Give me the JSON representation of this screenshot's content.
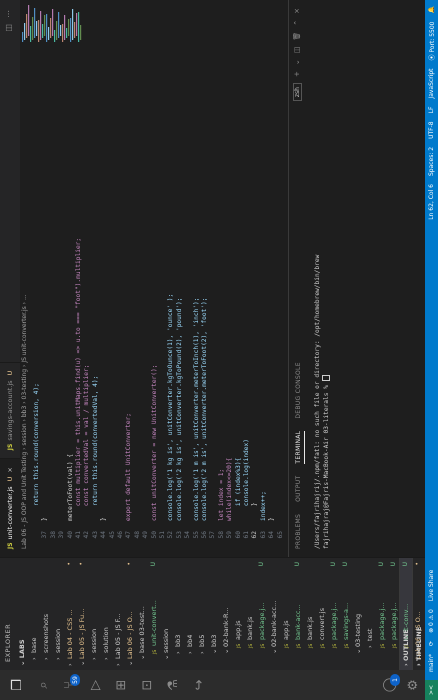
{
  "activity_bar": {
    "icons": [
      "explorer-icon",
      "search-icon",
      "source-control-icon",
      "run-debug-icon",
      "extensions-icon",
      "remote-explorer-icon",
      "testing-icon",
      "live-share-icon"
    ],
    "source_control_badge": "59",
    "bottom_icons": [
      "account-icon",
      "settings-icon"
    ],
    "account_badge": "1"
  },
  "sidebar": {
    "header": "EXPLORER",
    "section": "LABS",
    "items": [
      {
        "label": "base",
        "indent": 1,
        "arrow": "›",
        "status": "",
        "state": ""
      },
      {
        "label": "screenshots",
        "indent": 1,
        "arrow": "›",
        "status": "",
        "state": ""
      },
      {
        "label": "session",
        "indent": 1,
        "arrow": "›",
        "status": "",
        "state": ""
      },
      {
        "label": "Lab 04 - CSS ...",
        "indent": 0,
        "arrow": "›",
        "status": "•",
        "state": "mod"
      },
      {
        "label": "Lab 05 - JS Fu...",
        "indent": 0,
        "arrow": "⌄",
        "status": "•",
        "state": "mod"
      },
      {
        "label": "session",
        "indent": 1,
        "arrow": "›",
        "status": "",
        "state": ""
      },
      {
        "label": "solution",
        "indent": 1,
        "arrow": "›",
        "status": "",
        "state": ""
      },
      {
        "label": "Lab 05 - JS F...",
        "indent": 0,
        "arrow": "›",
        "status": "",
        "state": ""
      },
      {
        "label": "Lab 06 - JS O...",
        "indent": 0,
        "arrow": "⌄",
        "status": "•",
        "state": "mod"
      },
      {
        "label": "base 03-test...",
        "indent": 1,
        "arrow": "⌄",
        "status": "",
        "state": ""
      },
      {
        "label": "unit-convert...",
        "indent": 2,
        "arrow": "",
        "status": "U",
        "state": "untr"
      },
      {
        "label": "session",
        "indent": 1,
        "arrow": "⌄",
        "status": "",
        "state": ""
      },
      {
        "label": "bb3",
        "indent": 2,
        "arrow": "›",
        "status": "",
        "state": ""
      },
      {
        "label": "bb4",
        "indent": 2,
        "arrow": "›",
        "status": "",
        "state": ""
      },
      {
        "label": "bb5",
        "indent": 2,
        "arrow": "›",
        "status": "",
        "state": ""
      },
      {
        "label": "bb3",
        "indent": 2,
        "arrow": "⌄",
        "status": "",
        "state": ""
      },
      {
        "label": "02-bank-R...",
        "indent": 2,
        "arrow": "⌄",
        "status": "",
        "state": ""
      },
      {
        "label": "app.js",
        "indent": 3,
        "arrow": "",
        "status": "",
        "state": ""
      },
      {
        "label": "bank.js",
        "indent": 3,
        "arrow": "",
        "status": "",
        "state": ""
      },
      {
        "label": "package.j...",
        "indent": 3,
        "arrow": "",
        "status": "U",
        "state": "untr"
      },
      {
        "label": "02-bank-acc...",
        "indent": 2,
        "arrow": "⌄",
        "status": "",
        "state": ""
      },
      {
        "label": "app.js",
        "indent": 3,
        "arrow": "",
        "status": "",
        "state": ""
      },
      {
        "label": "bank-acc...",
        "indent": 3,
        "arrow": "",
        "status": "U",
        "state": "untr"
      },
      {
        "label": "bank.js",
        "indent": 3,
        "arrow": "",
        "status": "",
        "state": ""
      },
      {
        "label": "convert.js",
        "indent": 3,
        "arrow": "",
        "status": "",
        "state": ""
      },
      {
        "label": "package.j...",
        "indent": 3,
        "arrow": "",
        "status": "U",
        "state": "untr"
      },
      {
        "label": "savings-a...",
        "indent": 3,
        "arrow": "",
        "status": "U",
        "state": "untr"
      },
      {
        "label": "03-testing",
        "indent": 2,
        "arrow": "⌄",
        "status": "",
        "state": ""
      },
      {
        "label": "test",
        "indent": 3,
        "arrow": "›",
        "status": "",
        "state": ""
      },
      {
        "label": "package.j...",
        "indent": 3,
        "arrow": "",
        "status": "U",
        "state": "untr"
      },
      {
        "label": "package.j...",
        "indent": 3,
        "arrow": "",
        "status": "U",
        "state": "untr"
      },
      {
        "label": "unit-conv...",
        "indent": 3,
        "arrow": "",
        "status": "U",
        "state": "untr sel"
      },
      {
        "label": "Lab 06 - JS O...",
        "indent": 0,
        "arrow": "›",
        "status": "•",
        "state": "mod"
      },
      {
        "label": "Lab 07 - Classes",
        "indent": 0,
        "arrow": "›",
        "status": "",
        "state": ""
      }
    ],
    "outline": "OUTLINE",
    "timeline": "TIMELINE"
  },
  "tabs": [
    {
      "icon": "JS",
      "label": "unit-converter.js",
      "mark": "U",
      "active": true
    },
    {
      "icon": "JS",
      "label": "savings-account.js",
      "mark": "U",
      "active": false
    }
  ],
  "breadcrumb": "Lab 06 - JS OOP and Unit Testing › session › bb3 › 03-testing › JS unit-converter.js › ...",
  "code_lines": [
    {
      "n": "",
      "text": "    return this.round(conversion, 4);"
    },
    {
      "n": "37",
      "text": "}"
    },
    {
      "n": "38",
      "text": ""
    },
    {
      "n": "39",
      "text": ""
    },
    {
      "n": "40",
      "text": "meterToFoot(val) {"
    },
    {
      "n": "41",
      "text": "    const multiplier = this.unitMaps.find(u) => u.to === \"foot\").multiplier;"
    },
    {
      "n": "42",
      "text": "    const convertedVal = val / multiplier;"
    },
    {
      "n": "43",
      "text": "    return this.round(convertedVal, 4);"
    },
    {
      "n": "44",
      "text": "}"
    },
    {
      "n": "45",
      "text": ""
    },
    {
      "n": "46",
      "text": ""
    },
    {
      "n": "47",
      "text": "export default UnitConverter;"
    },
    {
      "n": "48",
      "text": ""
    },
    {
      "n": "49",
      "text": ""
    },
    {
      "n": "50",
      "text": "const unitConverter = new UnitConverter();"
    },
    {
      "n": "51",
      "text": ""
    },
    {
      "n": "52",
      "text": "console.log('1 kg is', unitConverter.kgToOunce(1), 'ounce' );"
    },
    {
      "n": "53",
      "text": "console.log('2 kg is', unitConverter.kgToPound(2), 'pound');"
    },
    {
      "n": "54",
      "text": ""
    },
    {
      "n": "55",
      "text": "console.log('1 m is', unitConverter.meterToInch(1), 'inch');"
    },
    {
      "n": "56",
      "text": "console.log('2 m is', unitConverter.meterToFoot(2), 'foot');"
    },
    {
      "n": "57",
      "text": ""
    },
    {
      "n": "58",
      "text": "let index = 1;"
    },
    {
      "n": "59",
      "text": "while(index<=20){"
    },
    {
      "n": "60",
      "text": "    if (index%3){"
    },
    {
      "n": "61",
      "text": "    console.log(index)"
    },
    {
      "n": "62",
      "text": "    }"
    },
    {
      "n": "63",
      "text": "index++;"
    },
    {
      "n": "64",
      "text": "}"
    },
    {
      "n": "65",
      "text": ""
    }
  ],
  "current_line": "62",
  "panel": {
    "tabs": [
      "PROBLEMS",
      "OUTPUT",
      "TERMINAL",
      "DEBUG CONSOLE"
    ],
    "active_tab": "TERMINAL",
    "shell_label": "zsh",
    "terminal_lines": [
      "/Users/fajrihajrij/.npm/fatl: no such file or directory: /opt/homebrew/bin/brew",
      "fajrihajraj@Fajris-MacBook-Air 03-literals % "
    ]
  },
  "statusbar": {
    "remote": "><",
    "branch": "main*",
    "sync": "⟳",
    "problems": "⊗ 0 ⚠ 0",
    "live_share": "Live Share",
    "position": "Ln 62, Col 6",
    "spaces": "Spaces: 2",
    "encoding": "UTF-8",
    "eol": "LF",
    "language": "JavaScript",
    "port": "⦿ Port: 5500"
  }
}
